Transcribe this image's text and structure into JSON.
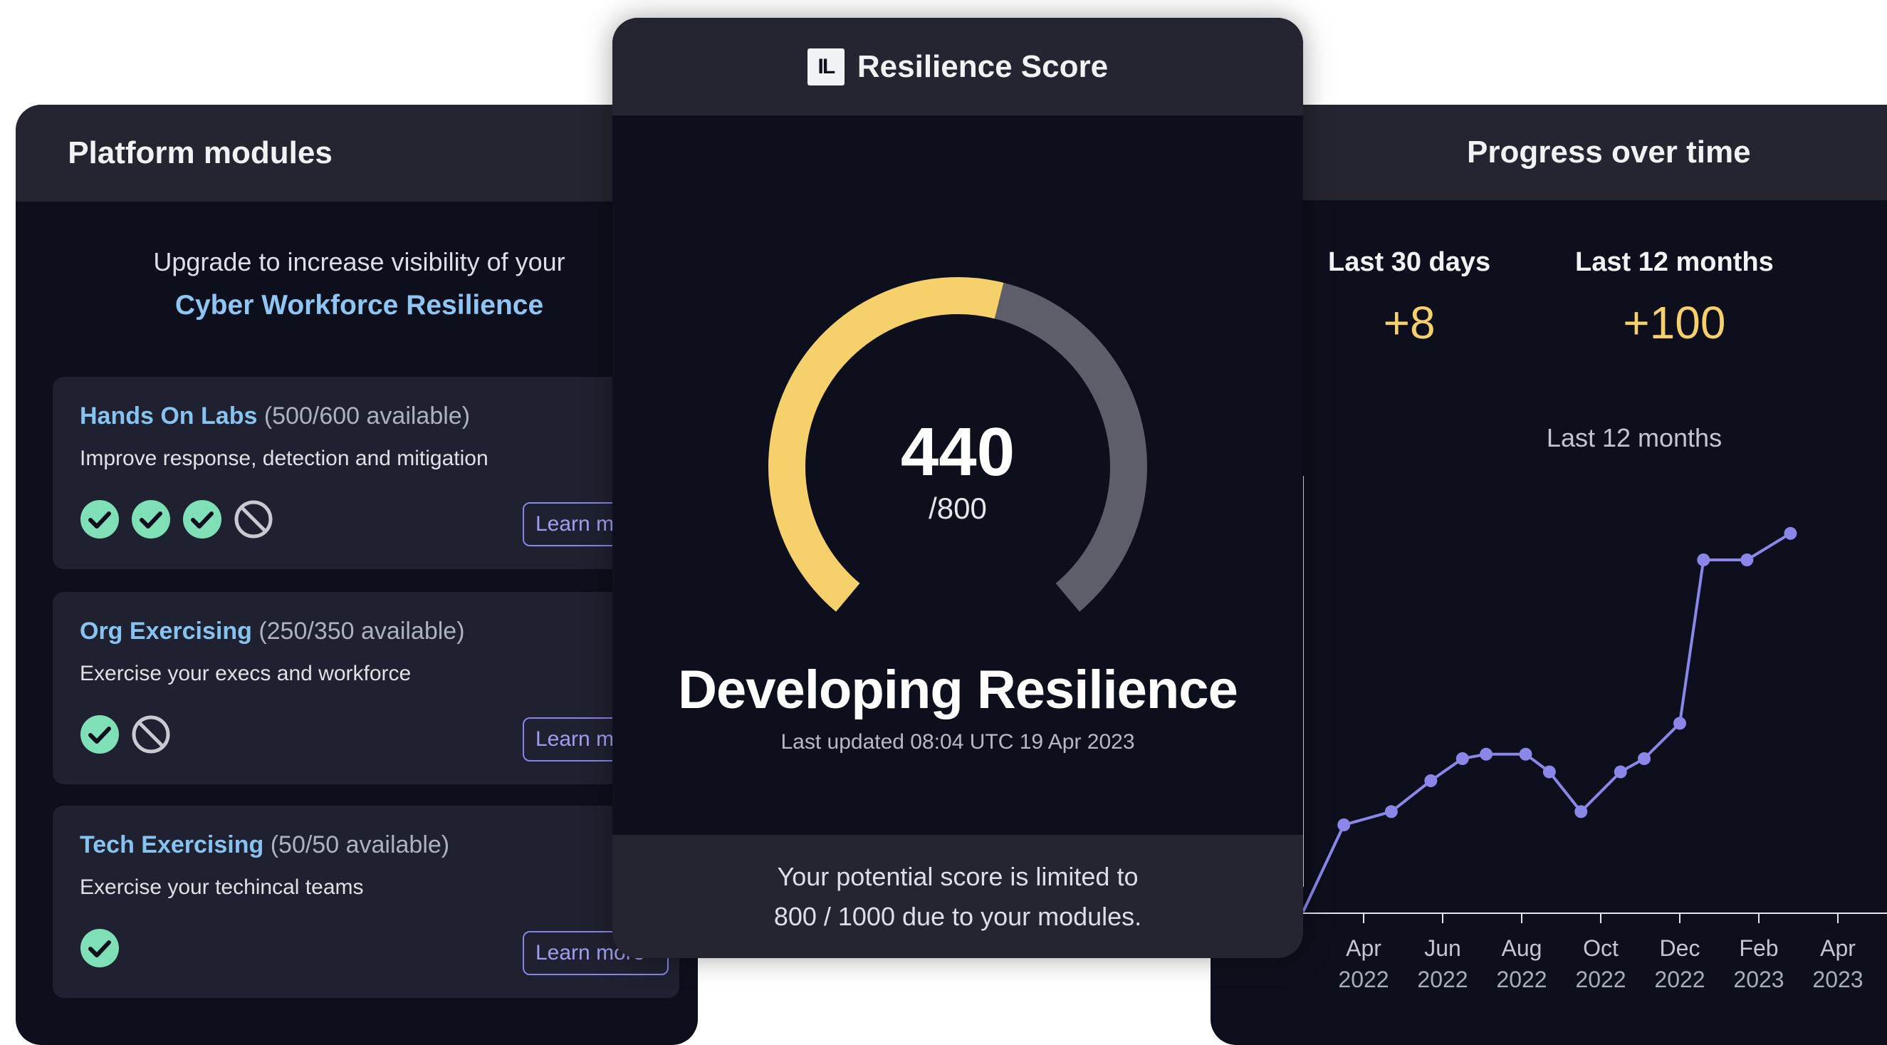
{
  "platform_modules": {
    "header": "Platform modules",
    "upgrade_line1": "Upgrade to increase visibility of your",
    "upgrade_line2": "Cyber Workforce Resilience",
    "modules": [
      {
        "name": "Hands On Labs",
        "availability": "(500/600 available)",
        "description": "Improve response, detection and mitigation",
        "badges": [
          "check-icon",
          "check-icon",
          "check-icon",
          "blocked-icon"
        ],
        "button": "Learn more"
      },
      {
        "name": "Org Exercising",
        "availability": "(250/350 available)",
        "description": "Exercise your execs and workforce",
        "badges": [
          "check-icon",
          "blocked-icon"
        ],
        "button": "Learn more"
      },
      {
        "name": "Tech Exercising",
        "availability": "(50/50 available)",
        "description": "Exercise your techincal teams",
        "badges": [
          "check-icon"
        ],
        "button": "Learn more"
      }
    ]
  },
  "resilience": {
    "logo": "IL",
    "header": "Resilience Score",
    "score": "440",
    "max": "/800",
    "score_value": 440,
    "max_value": 800,
    "level": "Developing Resilience",
    "last_updated": "Last updated 08:04 UTC 19 Apr 2023",
    "footer_line1": "Your potential score is limited to",
    "footer_line2": "800 / 1000 due to your modules."
  },
  "progress": {
    "header": "Progress over time",
    "stats": [
      {
        "label": "Last 30 days",
        "value": "+8"
      },
      {
        "label": "Last 12 months",
        "value": "+100"
      }
    ],
    "chart_title": "Last 12 months"
  },
  "chart_data": {
    "type": "line",
    "title": "Last 12 months",
    "x_ticks": [
      {
        "month": "Apr",
        "year": "2022"
      },
      {
        "month": "Jun",
        "year": "2022"
      },
      {
        "month": "Aug",
        "year": "2022"
      },
      {
        "month": "Oct",
        "year": "2022"
      },
      {
        "month": "Dec",
        "year": "2022"
      },
      {
        "month": "Feb",
        "year": "2023"
      },
      {
        "month": "Apr",
        "year": "2023"
      }
    ],
    "series": [
      {
        "points": [
          {
            "x": 0.75,
            "y": 0.2
          },
          {
            "x": 1.35,
            "y": 0.23
          },
          {
            "x": 1.85,
            "y": 0.3
          },
          {
            "x": 2.25,
            "y": 0.35
          },
          {
            "x": 2.55,
            "y": 0.36
          },
          {
            "x": 3.05,
            "y": 0.36
          },
          {
            "x": 3.35,
            "y": 0.32
          },
          {
            "x": 3.75,
            "y": 0.23
          },
          {
            "x": 4.25,
            "y": 0.32
          },
          {
            "x": 4.55,
            "y": 0.35
          },
          {
            "x": 5.0,
            "y": 0.43
          },
          {
            "x": 5.3,
            "y": 0.8
          },
          {
            "x": 5.85,
            "y": 0.8
          },
          {
            "x": 6.4,
            "y": 0.86
          }
        ]
      }
    ],
    "colors": {
      "line": "#8b86e8",
      "axis": "#e3e5ee"
    }
  },
  "colors": {
    "gauge_fill": "#f5d06b",
    "gauge_track": "#5d5e6a",
    "check": "#7fe0b7"
  }
}
